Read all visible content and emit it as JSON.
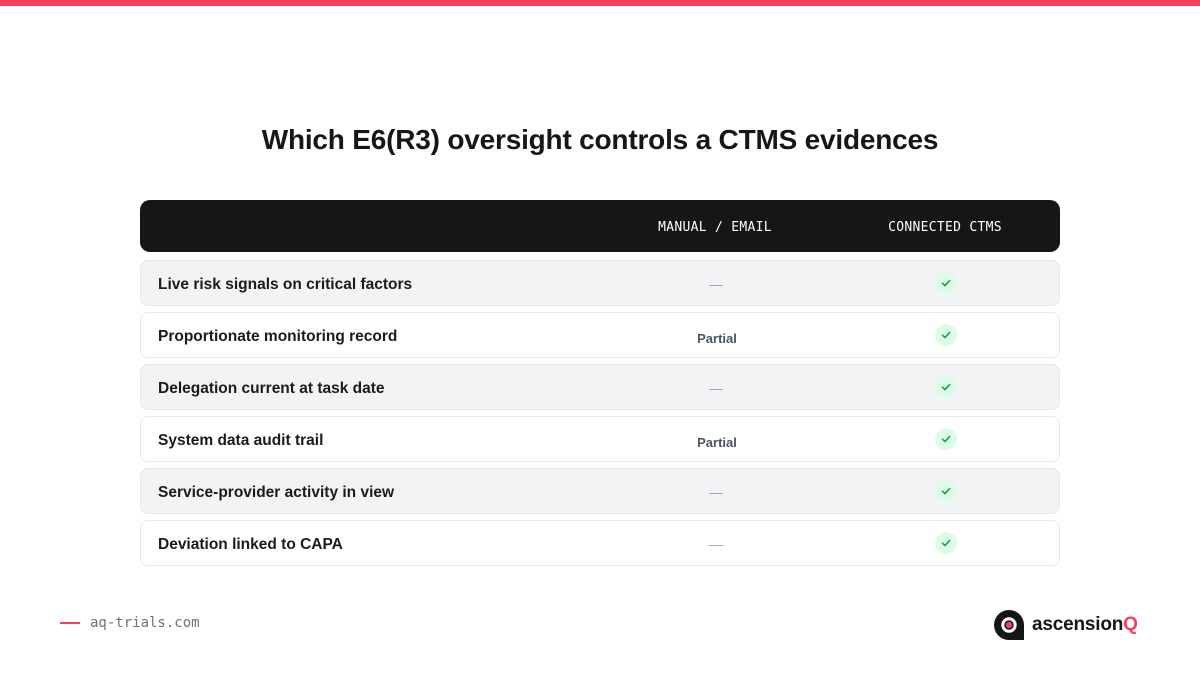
{
  "title": "Which E6(R3) oversight controls a CTMS evidences",
  "colors": {
    "accent": "#f43f5e",
    "header_bg": "#161616",
    "check_bg": "#dcfce7",
    "check_stroke": "#16a34a"
  },
  "table": {
    "columns": {
      "control": "",
      "manual": "MANUAL / EMAIL",
      "ctms": "CONNECTED CTMS"
    },
    "rows": [
      {
        "label": "Live risk signals on critical factors",
        "manual": "—",
        "ctms": "check-icon"
      },
      {
        "label": "Proportionate monitoring record",
        "manual": "Partial",
        "ctms": "check-icon"
      },
      {
        "label": "Delegation current at task date",
        "manual": "—",
        "ctms": "check-icon"
      },
      {
        "label": "System data audit trail",
        "manual": "Partial",
        "ctms": "check-icon"
      },
      {
        "label": "Service-provider activity in view",
        "manual": "—",
        "ctms": "check-icon"
      },
      {
        "label": "Deviation linked to CAPA",
        "manual": "—",
        "ctms": "check-icon"
      }
    ]
  },
  "footer": {
    "url": "aq-trials.com",
    "brand_name": "ascension",
    "brand_accent": "Q"
  }
}
